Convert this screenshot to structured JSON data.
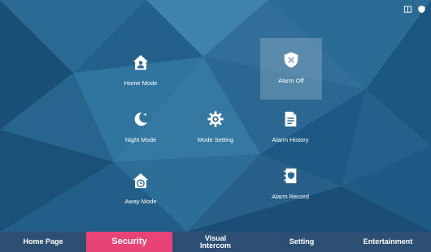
{
  "status_bar": {
    "icons": [
      "door-icon",
      "shield-icon"
    ]
  },
  "tiles": {
    "home_mode": {
      "label": "Home Mode",
      "icon": "home-person-icon"
    },
    "alarm_off": {
      "label": "Alarm Off",
      "icon": "shield-x-icon",
      "selected": true
    },
    "night_mode": {
      "label": "Night Mode",
      "icon": "moon-icon"
    },
    "mode_setting": {
      "label": "Mode Setting",
      "icon": "gear-icon"
    },
    "alarm_history": {
      "label": "Alarm History",
      "icon": "document-icon"
    },
    "away_mode": {
      "label": "Away Mode",
      "icon": "home-clock-icon"
    },
    "alarm_record": {
      "label": "Alarm Record",
      "icon": "record-book-icon"
    }
  },
  "nav": {
    "tabs": [
      {
        "label": "Home Page"
      },
      {
        "label": "Security",
        "active": true
      },
      {
        "label": "Visual\nIntercom"
      },
      {
        "label": "Setting"
      },
      {
        "label": "Entertainment"
      }
    ]
  },
  "colors": {
    "accent_active_tab": "#e84377",
    "navbar": "#2e4f74",
    "background": "#1f5d86"
  }
}
